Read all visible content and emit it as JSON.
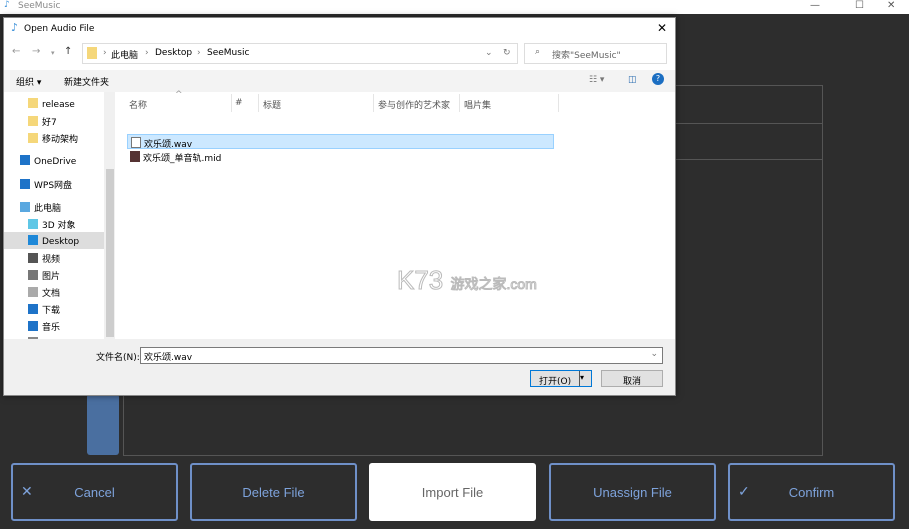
{
  "app": {
    "title": "SeeMusic",
    "icons": [
      "music-note-icon",
      "minimize-icon",
      "maximize-icon",
      "close-icon"
    ]
  },
  "buttons": {
    "cancel": "Cancel",
    "delete": "Delete File",
    "import": "Import File",
    "unassign": "Unassign File",
    "confirm": "Confirm"
  },
  "dialog": {
    "title": "Open Audio File",
    "breadcrumb": [
      "此电脑",
      "Desktop",
      "SeeMusic"
    ],
    "search_placeholder": "搜索\"SeeMusic\"",
    "toolbar": {
      "organize": "组织 ▾",
      "new_folder": "新建文件夹"
    },
    "sidebar": [
      {
        "label": "release",
        "icon": "folder-icon"
      },
      {
        "label": "好7",
        "icon": "folder-icon"
      },
      {
        "label": "移动架构",
        "icon": "folder-icon"
      },
      {
        "label": "OneDrive",
        "icon": "cloud-icon"
      },
      {
        "label": "WPS网盘",
        "icon": "cloud-icon"
      },
      {
        "label": "此电脑",
        "icon": "computer-icon"
      },
      {
        "label": "3D 对象",
        "icon": "cube-icon"
      },
      {
        "label": "Desktop",
        "icon": "desktop-icon",
        "selected": true
      },
      {
        "label": "视频",
        "icon": "video-icon"
      },
      {
        "label": "图片",
        "icon": "picture-icon"
      },
      {
        "label": "文档",
        "icon": "document-icon"
      },
      {
        "label": "下载",
        "icon": "download-icon"
      },
      {
        "label": "音乐",
        "icon": "music-icon"
      },
      {
        "label": "OS (C:)",
        "icon": "drive-icon"
      }
    ],
    "columns": [
      "名称",
      "#",
      "标题",
      "参与创作的艺术家",
      "唱片集"
    ],
    "files": [
      {
        "name": "欢乐颂.wav",
        "selected": true
      },
      {
        "name": "欢乐颂_单音轨.mid"
      }
    ],
    "filename_label": "文件名(N):",
    "filename_value": "欢乐颂.wav",
    "open": "打开(O)",
    "cancel": "取消"
  },
  "watermark": "K73 游戏之家 .com",
  "colors": {
    "accent": "#6f90c8",
    "background": "#2d2d2d"
  }
}
